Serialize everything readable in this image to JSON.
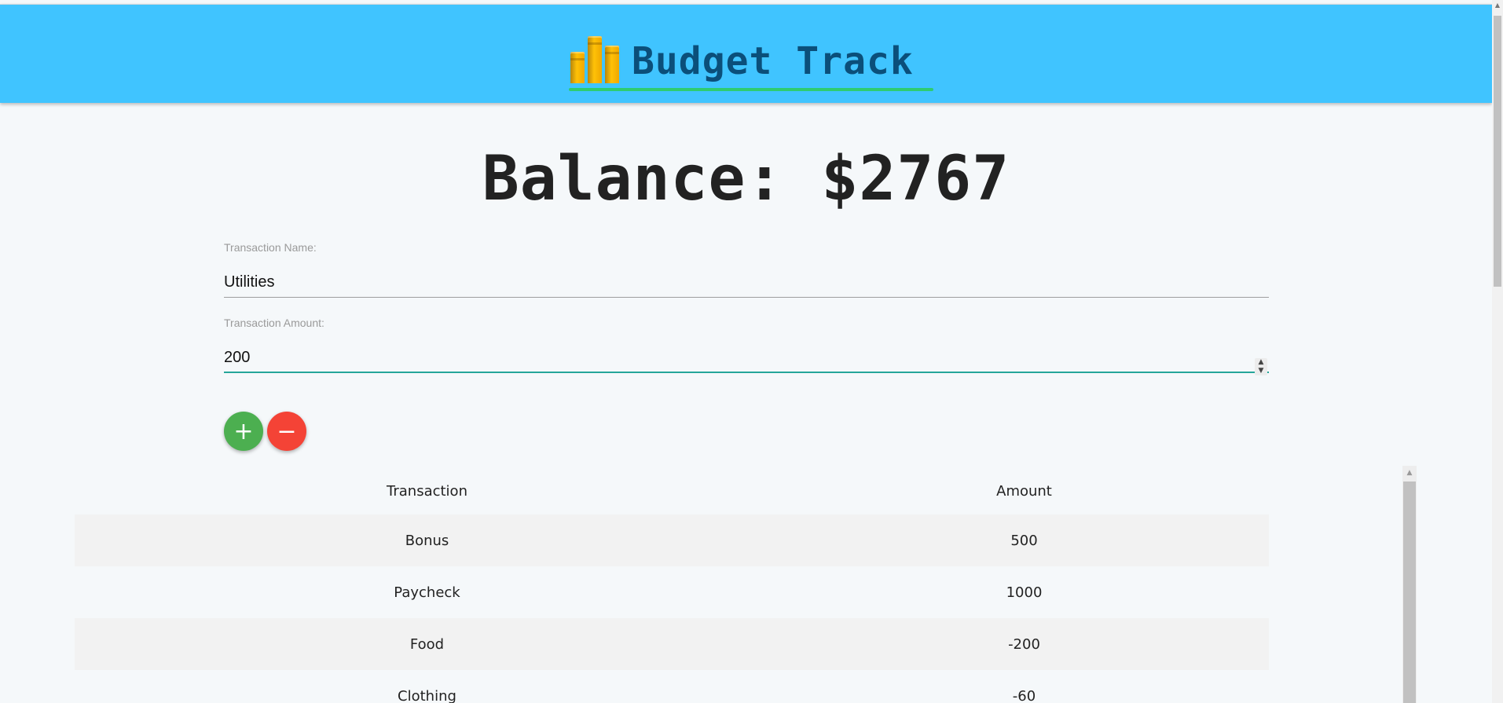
{
  "header": {
    "logo_text": "Budget Track"
  },
  "balance": {
    "text": "Balance: $2767"
  },
  "form": {
    "name_label": "Transaction Name:",
    "name_value": "Utilities",
    "amount_label": "Transaction Amount:",
    "amount_value": "200",
    "add_label": "+",
    "subtract_label": "−"
  },
  "table": {
    "headers": [
      "Transaction",
      "Amount"
    ],
    "rows": [
      {
        "name": "Bonus",
        "amount": "500"
      },
      {
        "name": "Paycheck",
        "amount": "1000"
      },
      {
        "name": "Food",
        "amount": "-200"
      },
      {
        "name": "Clothing",
        "amount": "-60"
      }
    ]
  },
  "colors": {
    "header_bg": "#40c4ff",
    "add_button": "#4caf50",
    "subtract_button": "#f44336",
    "active_underline": "#26a69a",
    "logo_text": "#0b4f7a",
    "logo_underline": "#2ecc71"
  },
  "icons": {
    "logo": "bar-chart-coins-icon",
    "add": "plus-icon",
    "subtract": "minus-icon",
    "spinner": "number-spinner-icon"
  }
}
